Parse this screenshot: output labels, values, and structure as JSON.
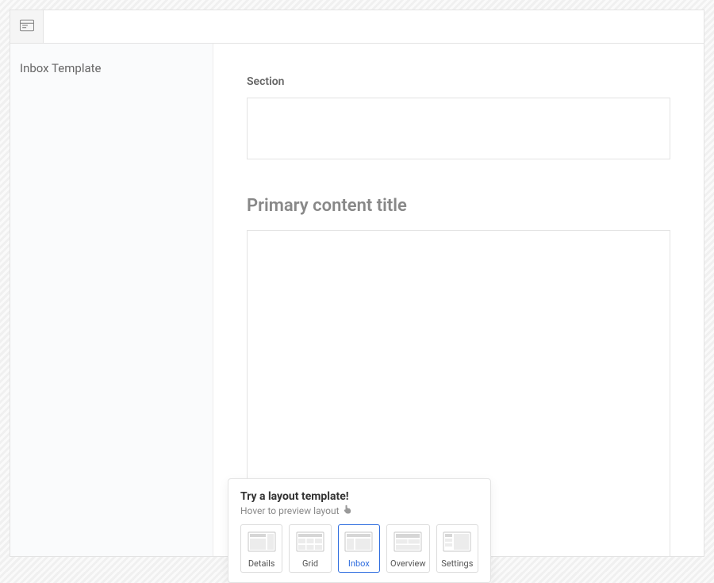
{
  "sidebar": {
    "title": "Inbox Template"
  },
  "main": {
    "section_label": "Section",
    "primary_title": "Primary content title"
  },
  "popover": {
    "title": "Try a layout template!",
    "subtitle": "Hover to preview layout",
    "templates": [
      {
        "label": "Details",
        "selected": false
      },
      {
        "label": "Grid",
        "selected": false
      },
      {
        "label": "Inbox",
        "selected": true
      },
      {
        "label": "Overview",
        "selected": false
      },
      {
        "label": "Settings",
        "selected": false
      }
    ]
  }
}
